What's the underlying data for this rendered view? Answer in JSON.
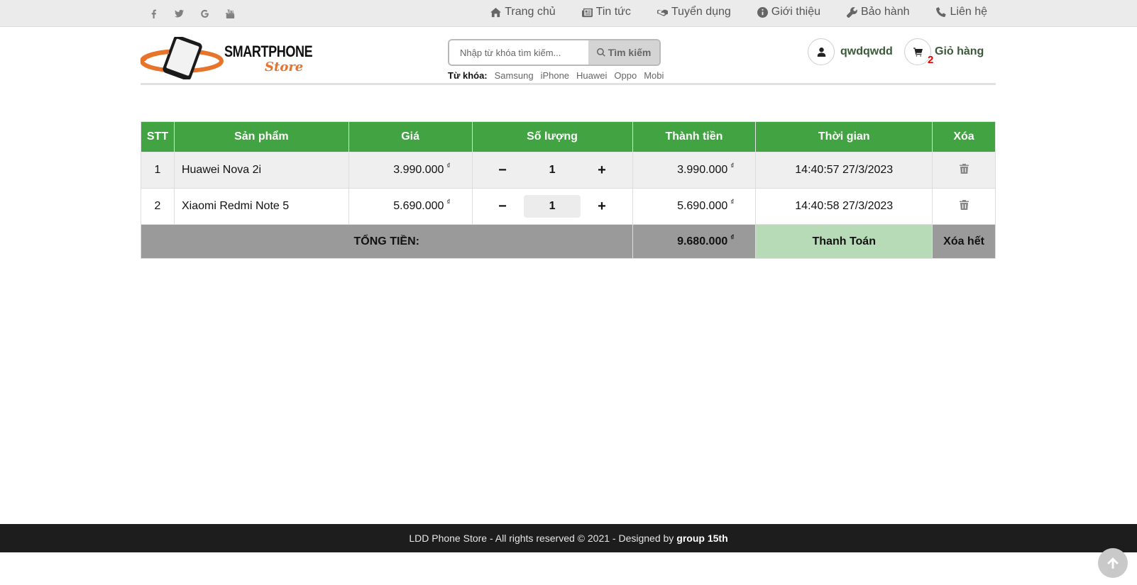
{
  "topbar": {
    "social": [
      "facebook-icon",
      "twitter-icon",
      "google-icon",
      "youtube-icon"
    ],
    "nav": [
      {
        "icon": "home-icon",
        "label": "Trang chủ"
      },
      {
        "icon": "newspaper-icon",
        "label": "Tin tức"
      },
      {
        "icon": "handshake-icon",
        "label": "Tuyển dụng"
      },
      {
        "icon": "info-icon",
        "label": "Giới thiệu"
      },
      {
        "icon": "wrench-icon",
        "label": "Bảo hành"
      },
      {
        "icon": "phone-icon",
        "label": "Liên hệ"
      }
    ]
  },
  "header": {
    "logo_line1": "SMARTPHONE",
    "logo_line2": "Store",
    "search_placeholder": "Nhập từ khóa tìm kiếm...",
    "search_button": "Tìm kiếm",
    "keywords_label": "Từ khóa:",
    "keywords": [
      "Samsung",
      "iPhone",
      "Huawei",
      "Oppo",
      "Mobi"
    ],
    "user_name": "qwdqwdd",
    "cart_count": "2",
    "cart_label": "Giỏ hàng"
  },
  "cart": {
    "headers": {
      "stt": "STT",
      "product": "Sản phẩm",
      "price": "Giá",
      "quantity": "Số lượng",
      "subtotal": "Thành tiền",
      "time": "Thời gian",
      "delete": "Xóa"
    },
    "currency": "₫",
    "qty_minus": "−",
    "qty_plus": "+",
    "rows": [
      {
        "stt": "1",
        "name": "Huawei Nova 2i",
        "price": "3.990.000",
        "qty": "1",
        "subtotal": "3.990.000",
        "time": "14:40:57 27/3/2023"
      },
      {
        "stt": "2",
        "name": "Xiaomi Redmi Note 5",
        "price": "5.690.000",
        "qty": "1",
        "subtotal": "5.690.000",
        "time": "14:40:58 27/3/2023"
      }
    ],
    "total_label": "TỔNG TIỀN:",
    "total_value": "9.680.000",
    "pay_label": "Thanh Toán",
    "clear_label": "Xóa hết"
  },
  "footer": {
    "text": "LDD Phone Store - All rights reserved © 2021 - Designed by",
    "designer": "group 15th"
  }
}
